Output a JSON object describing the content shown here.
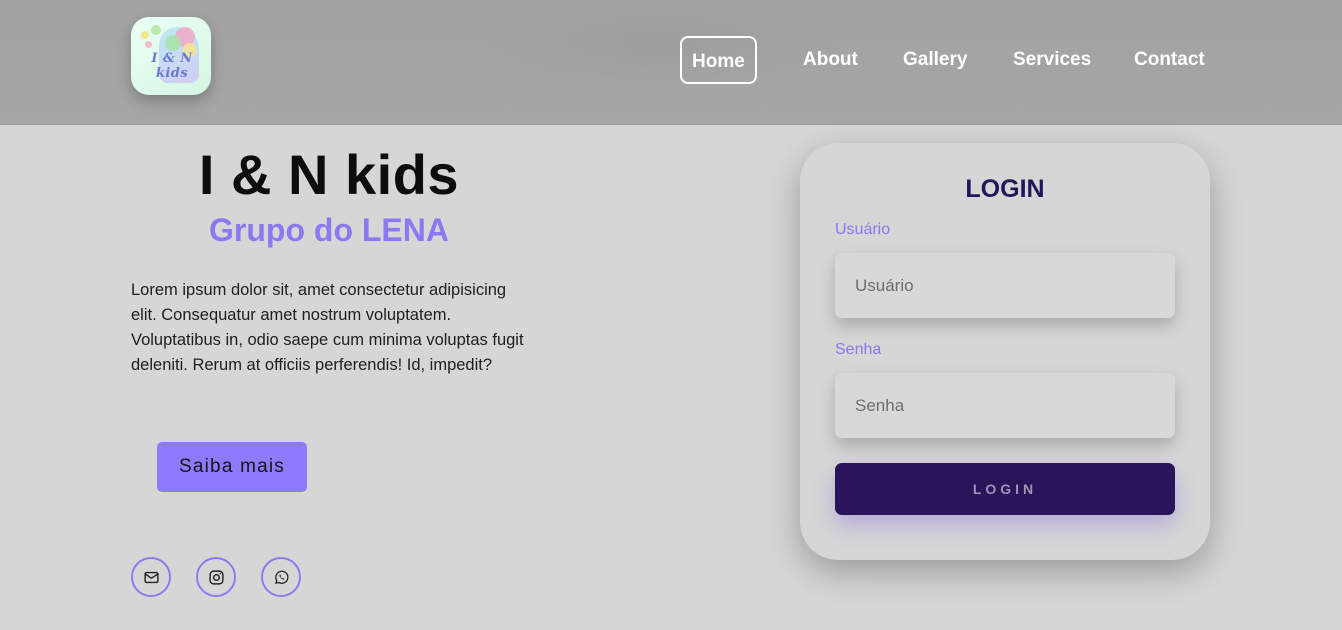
{
  "header": {
    "logo_text": "I & N kids",
    "nav": [
      {
        "label": "Home",
        "active": true
      },
      {
        "label": "About",
        "active": false
      },
      {
        "label": "Gallery",
        "active": false
      },
      {
        "label": "Services",
        "active": false
      },
      {
        "label": "Contact",
        "active": false
      }
    ]
  },
  "hero": {
    "title": "I & N kids",
    "subtitle": "Grupo do LENA",
    "text": "Lorem ipsum dolor sit, amet consectetur adipisicing elit. Consequatur amet nostrum voluptatem. Voluptatibus in, odio saepe cum minima voluptas fugit deleniti. Rerum at officiis perferendis! Id, impedit?",
    "cta_label": "Saiba mais",
    "social_icons": [
      "mail-icon",
      "instagram-icon",
      "whatsapp-icon"
    ]
  },
  "login": {
    "title": "LOGIN",
    "user_label": "Usuário",
    "user_placeholder": "Usuário",
    "user_value": "",
    "pass_label": "Senha",
    "pass_placeholder": "Senha",
    "pass_value": "",
    "button_label": "LOGIN"
  },
  "colors": {
    "accent": "#8b7bfa",
    "dark_purple": "#2a155b",
    "background": "#d6d6d6",
    "header": "#a4a4a4"
  }
}
